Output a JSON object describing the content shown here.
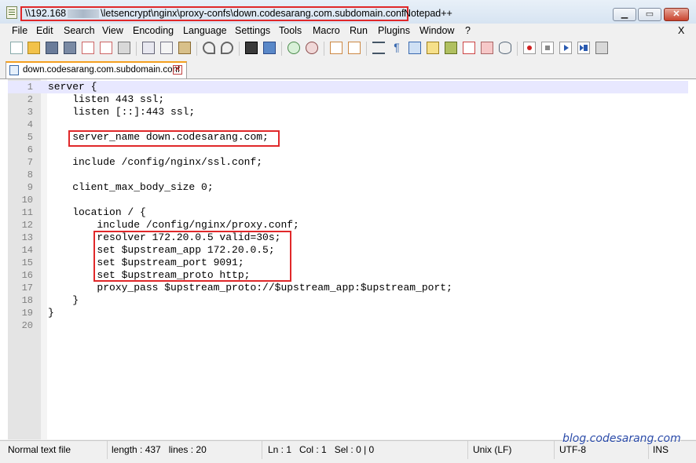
{
  "titlebar": {
    "path_prefix": "\\\\192.168",
    "path_suffix": "\\letsencrypt\\nginx\\proxy-confs\\down.codesarang.com.subdomain.conf",
    "app_name": "Notepad++",
    "minimize": "▁",
    "maximize": "▭",
    "close": "✕"
  },
  "menu": {
    "items": [
      "File",
      "Edit",
      "Search",
      "View",
      "Encoding",
      "Language",
      "Settings",
      "Tools",
      "Macro",
      "Run",
      "Plugins",
      "Window",
      "?"
    ],
    "close_doc": "X"
  },
  "toolbar": {
    "icons": [
      "new-file-icon",
      "open-file-icon",
      "save-icon",
      "save-all-icon",
      "close-icon",
      "close-all-icon",
      "print-icon",
      "cut-icon",
      "copy-icon",
      "paste-icon",
      "undo-icon",
      "redo-icon",
      "find-icon",
      "replace-icon",
      "zoom-in-icon",
      "zoom-out-icon",
      "sync-vertical-icon",
      "sync-horizontal-icon",
      "word-wrap-icon",
      "show-all-chars-icon",
      "indent-guide-icon",
      "doc-map-icon",
      "function-list-icon",
      "folder-workspace-icon",
      "monitor-icon",
      "record-macro-icon",
      "stop-macro-icon",
      "play-macro-icon",
      "run-macro-multiple-icon",
      "save-macro-icon"
    ]
  },
  "tab": {
    "label": "down.codesarang.com.subdomain.conf",
    "close": "✕"
  },
  "editor": {
    "current_line": 1,
    "lines": [
      "server {",
      "    listen 443 ssl;",
      "    listen [::]:443 ssl;",
      "",
      "    server_name down.codesarang.com;",
      "",
      "    include /config/nginx/ssl.conf;",
      "",
      "    client_max_body_size 0;",
      "",
      "    location / {",
      "        include /config/nginx/proxy.conf;",
      "        resolver 172.20.0.5 valid=30s;",
      "        set $upstream_app 172.20.0.5;",
      "        set $upstream_port 9091;",
      "        set $upstream_proto http;",
      "        proxy_pass $upstream_proto://$upstream_app:$upstream_port;",
      "    }",
      "}",
      ""
    ]
  },
  "statusbar": {
    "file_type": "Normal text file",
    "length": "length : 437",
    "lines": "lines : 20",
    "ln": "Ln : 1",
    "col": "Col : 1",
    "sel": "Sel : 0 | 0",
    "eol": "Unix (LF)",
    "encoding": "UTF-8",
    "mode": "INS"
  },
  "watermark": "blog.codesarang.com",
  "colors": {
    "highlight_box": "#e0282a",
    "tab_accent": "#f4a020",
    "current_line": "#e8e8ff",
    "watermark": "#2a4aa8"
  }
}
